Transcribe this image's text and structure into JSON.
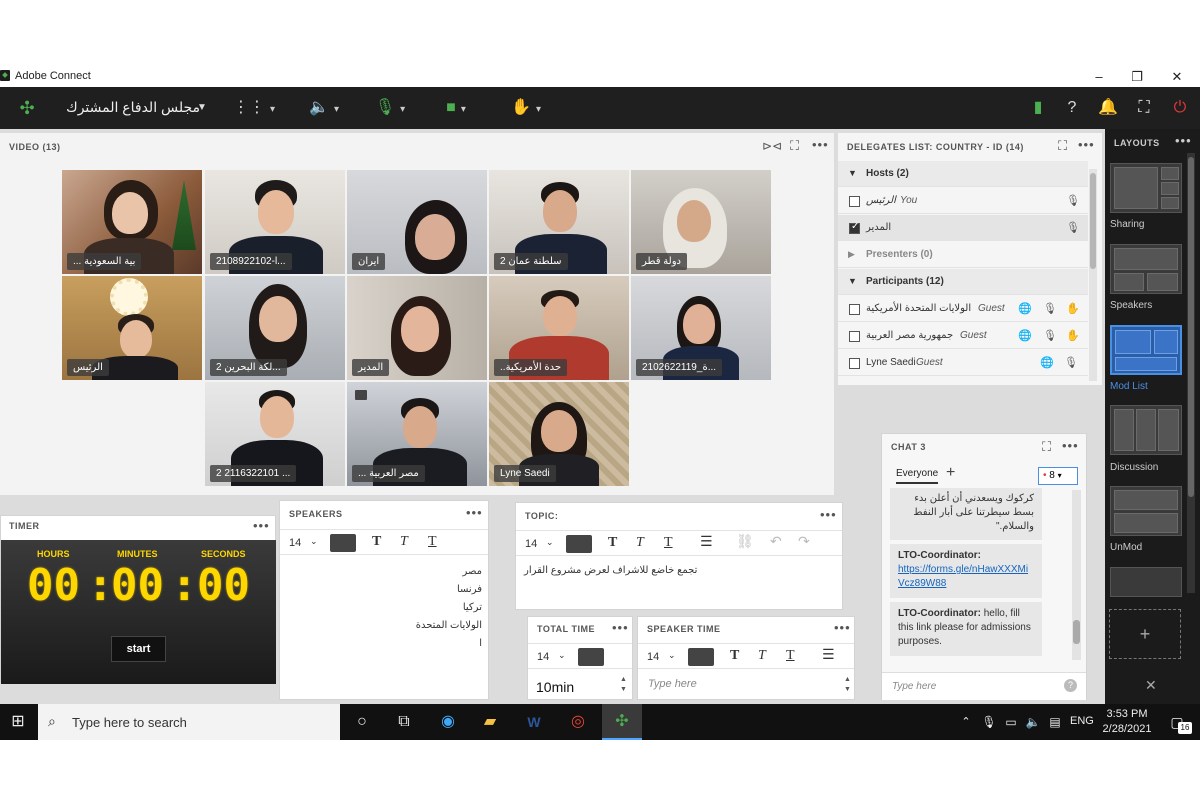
{
  "window": {
    "title": "Adobe Connect",
    "controls": [
      "–",
      "❐",
      "✕"
    ]
  },
  "appbar": {
    "room_name": "مجلس الدفاع المشترك"
  },
  "video": {
    "header": "VIDEO (13)",
    "tiles": [
      {
        "label": "... بية السعودية"
      },
      {
        "label": "2108922102-l..."
      },
      {
        "label": "ايران"
      },
      {
        "label": "سلطنة عمان 2"
      },
      {
        "label": "دولة قطر"
      },
      {
        "label": "الرئيس"
      },
      {
        "label": "لكة البحرين 2..."
      },
      {
        "label": "المدير"
      },
      {
        "label": "..حدة الأمريكية"
      },
      {
        "label": "2102622119_ة..."
      },
      {
        "label": "2 2116322101 ..."
      },
      {
        "label": "... مصر العربية"
      },
      {
        "label": "Lyne Saedi"
      }
    ]
  },
  "delegates": {
    "header": "DELEGATES LIST: COUNTRY - ID  (14)",
    "hosts_label": "Hosts (2)",
    "host1_name": "الرئيس",
    "host1_tag": "You",
    "host2_name": "المدير",
    "presenters_label": "Presenters (0)",
    "participants_label": "Participants (12)",
    "p1_name": "الولايات المتحدة الأمريكية",
    "p1_tag": "Guest",
    "p2_name": "جمهورية مصر العربية",
    "p2_tag": "Guest",
    "p3_name": "Lyne Saedi",
    "p3_tag": "Guest"
  },
  "layouts": {
    "header": "LAYOUTS",
    "items": [
      "Sharing",
      "Speakers",
      "Mod List",
      "Discussion",
      "UnMod"
    ],
    "add": "+"
  },
  "chat": {
    "header": "CHAT 3",
    "tab": "Everyone",
    "add": "+",
    "badge": "8",
    "msg0": "كركوك ويسعدني أن أعلن بدء بسط سيطرتنا على أبار النفط والسلام.\"",
    "msg1_sender": "LTO-Coordinator:",
    "msg1_link": "https://forms.gle/nHawXXXMiVcz89W88",
    "msg2_sender": "LTO-Coordinator:",
    "msg2_text": "hello, fill this link please for admissions purposes.",
    "input_placeholder": "Type here"
  },
  "timer": {
    "header": "TIMER",
    "hours_label": "HOURS",
    "minutes_label": "MINUTES",
    "seconds_label": "SECONDS",
    "hours": "00",
    "minutes": "00",
    "seconds": "00",
    "start_label": "start"
  },
  "speakers": {
    "header": "SPEAKERS",
    "font_size": "14",
    "lines": [
      "مصر",
      "فرنسا",
      "تركيا",
      "الولايات المتحدة",
      "ا"
    ]
  },
  "topic": {
    "header": "TOPIC:",
    "font_size": "14",
    "text": "تجمع خاضع للاشراف لعرض مشروع القرار"
  },
  "total_time": {
    "header": "TOTAL TIME",
    "font_size": "14",
    "value": "10min"
  },
  "speaker_time": {
    "header": "SPEAKER TIME",
    "font_size": "14",
    "placeholder": "Type here"
  },
  "taskbar": {
    "search_placeholder": "Type here to search",
    "lang": "ENG",
    "time": "3:53 PM",
    "date": "2/28/2021",
    "notif_count": "16"
  }
}
